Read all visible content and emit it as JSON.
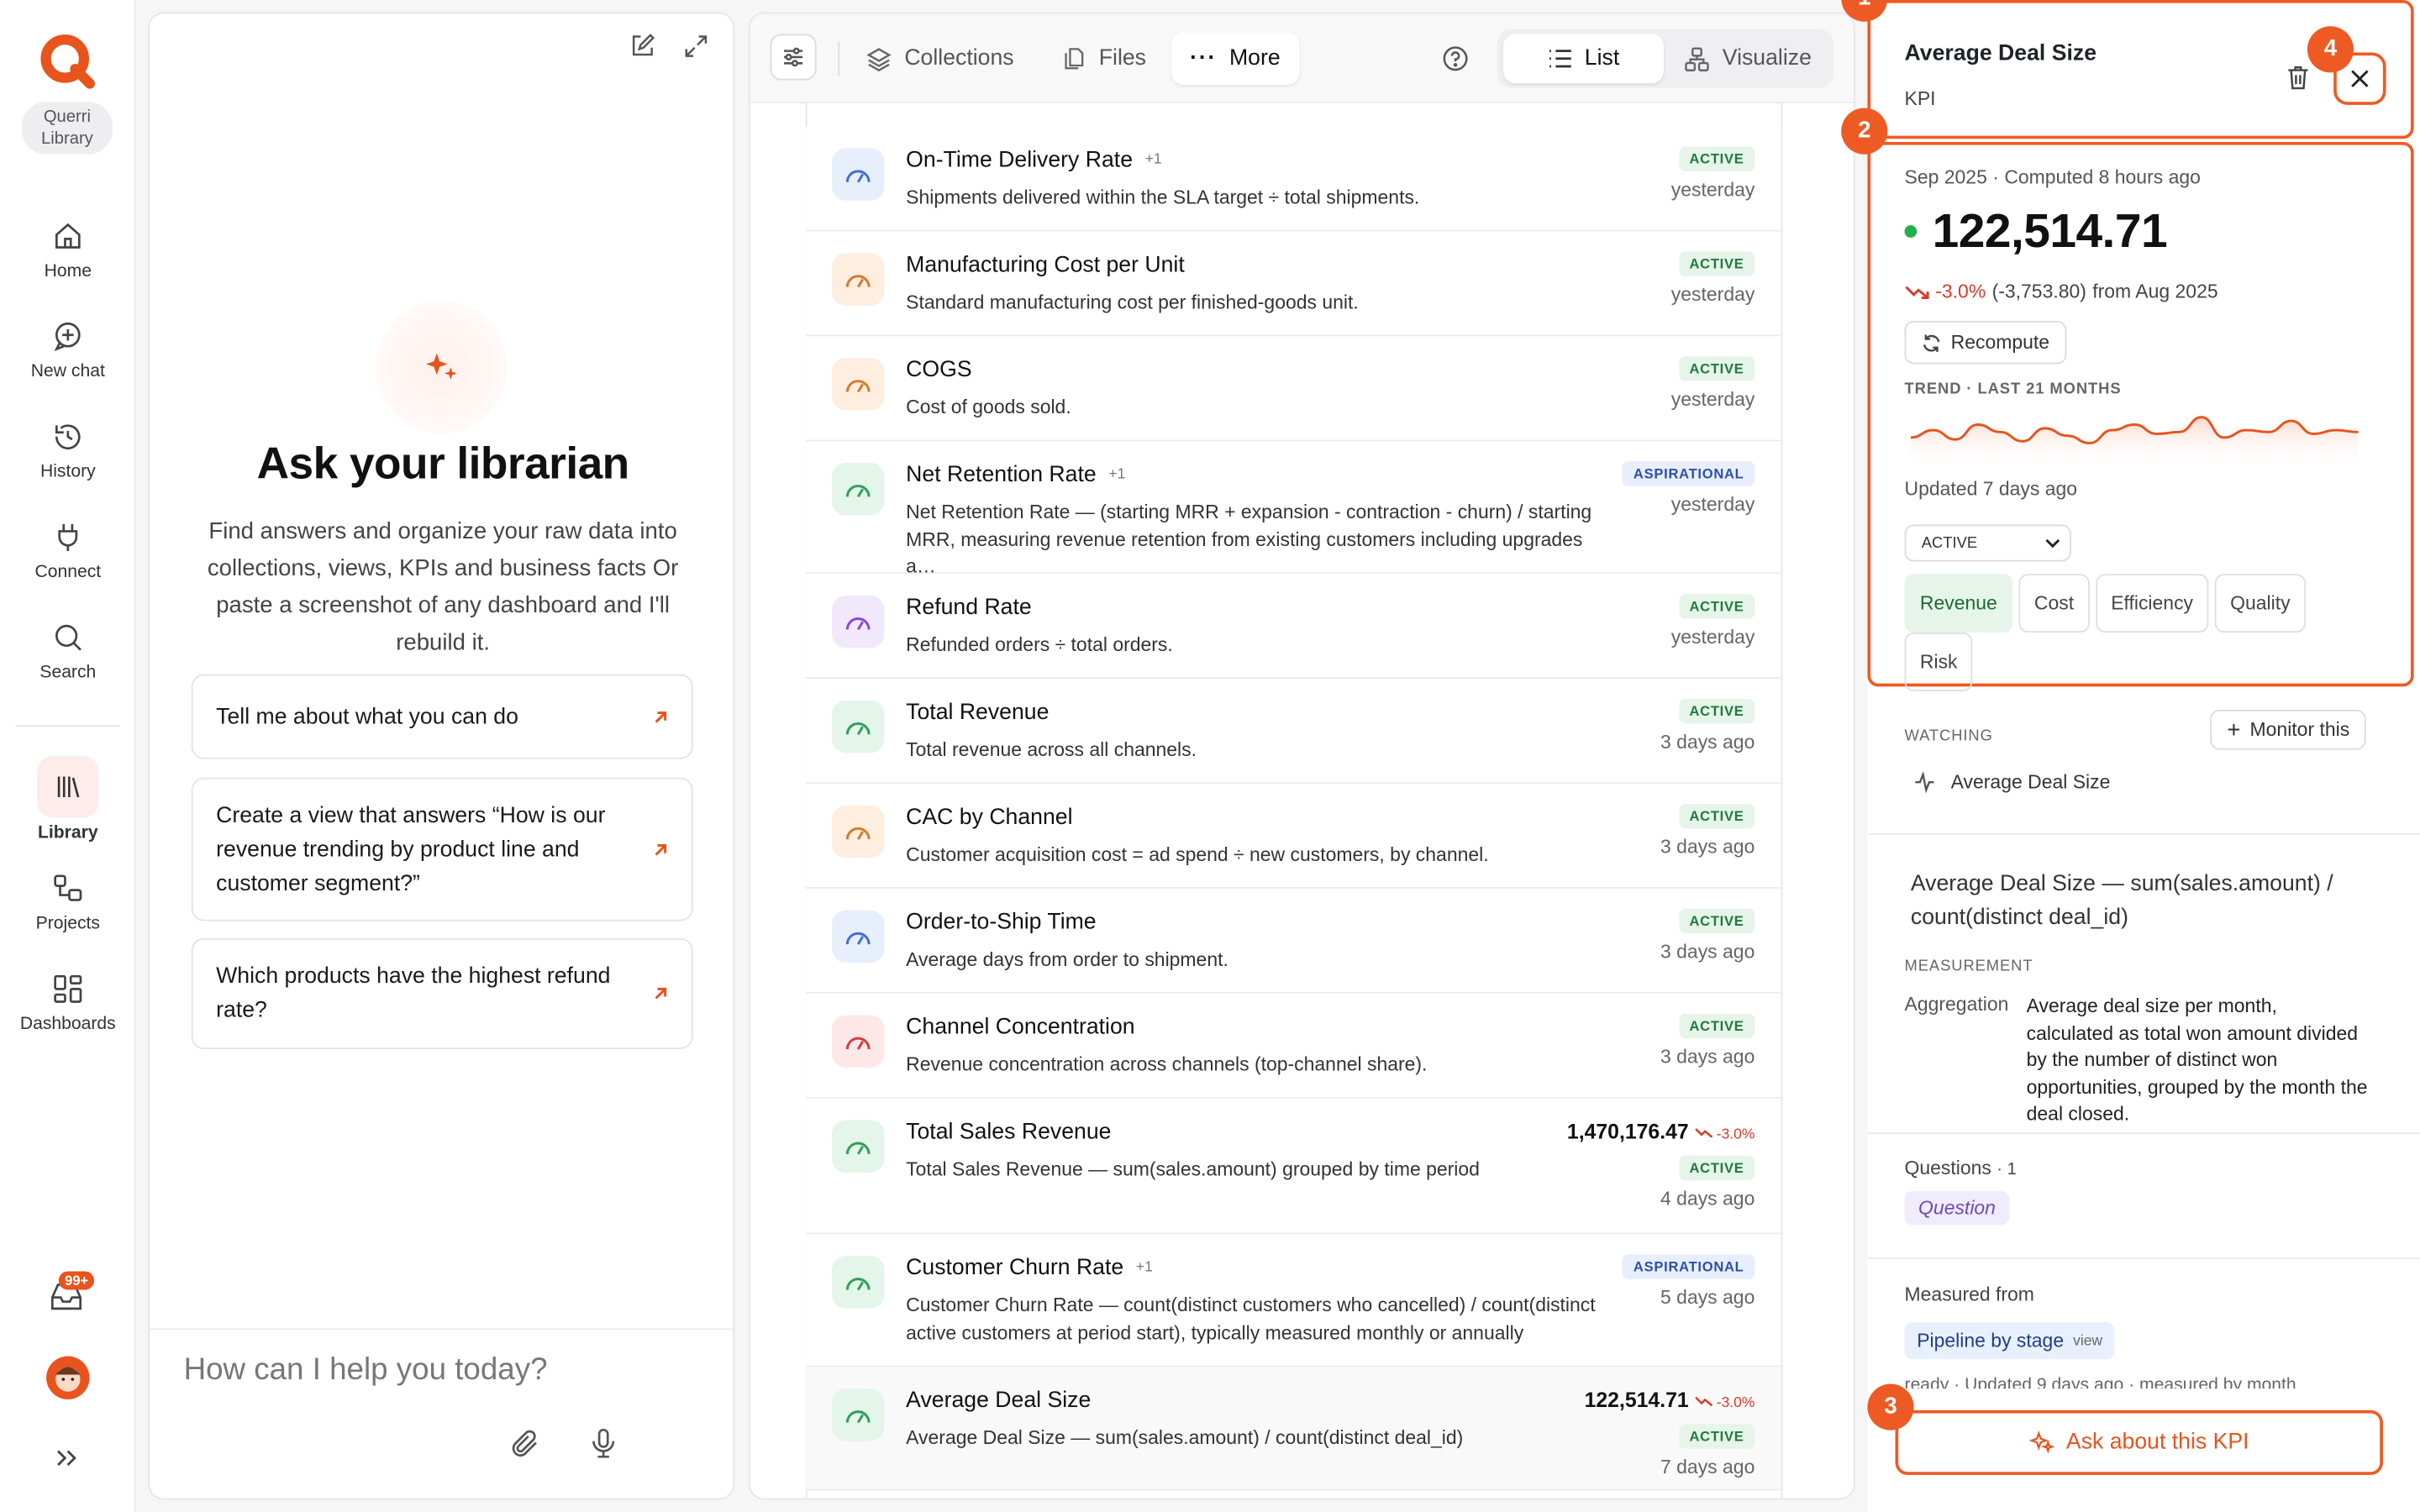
{
  "nav": {
    "library_pill": [
      "Querri",
      "Library"
    ],
    "items": [
      {
        "id": "home",
        "label": "Home",
        "icon": "home-icon"
      },
      {
        "id": "new-chat",
        "label": "New chat",
        "icon": "chat-plus-icon"
      },
      {
        "id": "history",
        "label": "History",
        "icon": "history-icon"
      },
      {
        "id": "connect",
        "label": "Connect",
        "icon": "plug-icon"
      },
      {
        "id": "search",
        "label": "Search",
        "icon": "search-icon"
      },
      {
        "id": "library",
        "label": "Library",
        "icon": "library-icon",
        "active": true
      },
      {
        "id": "projects",
        "label": "Projects",
        "icon": "projects-icon"
      },
      {
        "id": "dashboards",
        "label": "Dashboards",
        "icon": "dashboard-icon"
      }
    ],
    "inbox_badge": "99+"
  },
  "chat": {
    "title": "Ask your librarian",
    "subtitle": "Find answers and organize your raw data into collections, views, KPIs and business facts Or paste a screenshot of any dashboard and I'll rebuild it.",
    "suggestions": [
      "Tell me about what you can do",
      "Create a view that answers “How is our revenue trending by product line and customer segment?”",
      "Which products have the highest refund rate?"
    ],
    "input_placeholder": "How can I help you today?"
  },
  "toolbar": {
    "collections": "Collections",
    "files": "Files",
    "more": "More",
    "list": "List",
    "visualize": "Visualize"
  },
  "kpis": [
    {
      "name": "On-Time Delivery Rate",
      "plus": "+1",
      "desc": "Shipments delivered within the SLA target ÷ total shipments.",
      "status": "ACTIVE",
      "time": "yesterday",
      "color": "#3b6fd8",
      "bg": "#e7effc"
    },
    {
      "name": "Manufacturing Cost per Unit",
      "plus": "",
      "desc": "Standard manufacturing cost per finished-goods unit.",
      "status": "ACTIVE",
      "time": "yesterday",
      "color": "#d9792b",
      "bg": "#fdeedf"
    },
    {
      "name": "COGS",
      "plus": "",
      "desc": "Cost of goods sold.",
      "status": "ACTIVE",
      "time": "yesterday",
      "color": "#d9792b",
      "bg": "#fdeedf"
    },
    {
      "name": "Net Retention Rate",
      "plus": "+1",
      "desc": "Net Retention Rate — (starting MRR + expansion - contraction - churn) / starting MRR, measuring revenue retention from existing customers including upgrades a…",
      "status": "ASPIRATIONAL",
      "time": "yesterday",
      "color": "#2f9e5a",
      "bg": "#e4f5ea"
    },
    {
      "name": "Refund Rate",
      "plus": "",
      "desc": "Refunded orders ÷ total orders.",
      "status": "ACTIVE",
      "time": "yesterday",
      "color": "#8e47d6",
      "bg": "#f1e8fb"
    },
    {
      "name": "Total Revenue",
      "plus": "",
      "desc": "Total revenue across all channels.",
      "status": "ACTIVE",
      "time": "3 days ago",
      "color": "#2f9e5a",
      "bg": "#e4f5ea"
    },
    {
      "name": "CAC by Channel",
      "plus": "",
      "desc": "Customer acquisition cost = ad spend ÷ new customers, by channel.",
      "status": "ACTIVE",
      "time": "3 days ago",
      "color": "#d9792b",
      "bg": "#fdeedf"
    },
    {
      "name": "Order-to-Ship Time",
      "plus": "",
      "desc": "Average days from order to shipment.",
      "status": "ACTIVE",
      "time": "3 days ago",
      "color": "#3b6fd8",
      "bg": "#e7effc"
    },
    {
      "name": "Channel Concentration",
      "plus": "",
      "desc": "Revenue concentration across channels (top-channel share).",
      "status": "ACTIVE",
      "time": "3 days ago",
      "color": "#d23b3b",
      "bg": "#fde7e7"
    },
    {
      "name": "Total Sales Revenue",
      "plus": "",
      "desc": "Total Sales Revenue — sum(sales.amount) grouped by time period",
      "status": "ACTIVE",
      "time": "4 days ago",
      "value": "1,470,176.47",
      "change": "-3.0%",
      "color": "#2f9e5a",
      "bg": "#e4f5ea"
    },
    {
      "name": "Customer Churn Rate",
      "plus": "+1",
      "desc": "Customer Churn Rate — count(distinct customers who cancelled) / count(distinct active customers at period start), typically measured monthly or annually",
      "status": "ASPIRATIONAL",
      "time": "5 days ago",
      "color": "#2f9e5a",
      "bg": "#e4f5ea"
    },
    {
      "name": "Average Deal Size",
      "plus": "",
      "desc": "Average Deal Size — sum(sales.amount) / count(distinct deal_id)",
      "status": "ACTIVE",
      "time": "7 days ago",
      "value": "122,514.71",
      "change": "-3.0%",
      "color": "#2f9e5a",
      "bg": "#e4f5ea",
      "highlight": true
    }
  ],
  "detail": {
    "title": "Average Deal Size",
    "kind": "KPI",
    "period": "Sep 2025",
    "computed": "Computed 8 hours ago",
    "value": "122,514.71",
    "change_pct": "-3.0%",
    "change_abs": "(-3,753.80)",
    "change_from": "from Aug 2025",
    "recompute": "Recompute",
    "trend_label": "TREND · LAST 21 MONTHS",
    "trend": [
      0.35,
      0.55,
      0.3,
      0.7,
      0.5,
      0.25,
      0.6,
      0.4,
      0.2,
      0.55,
      0.7,
      0.45,
      0.5,
      0.9,
      0.35,
      0.55,
      0.5,
      0.8,
      0.45,
      0.55,
      0.5
    ],
    "updated": "Updated 7 days ago",
    "status_select": "ACTIVE",
    "tags": [
      {
        "label": "Revenue",
        "on": true
      },
      {
        "label": "Cost"
      },
      {
        "label": "Efficiency"
      },
      {
        "label": "Quality"
      },
      {
        "label": "Risk"
      }
    ],
    "watching_label": "WATCHING",
    "monitor": "Monitor this",
    "watching_item": "Average Deal Size",
    "formula": "Average Deal Size — sum(sales.amount) / count(distinct deal_id)",
    "measurement_label": "MEASUREMENT",
    "aggregation_key": "Aggregation",
    "aggregation_val": "Average deal size per month, calculated as total won amount divided by the number of distinct won opportunities, grouped by the month the deal closed.",
    "questions_label": "Questions",
    "questions_count": "· 1",
    "question_chip": "Question",
    "measured_from": "Measured from",
    "source": "Pipeline by stage",
    "source_kind": "view",
    "source_meta": "ready · Updated 9 days ago · measured by month",
    "ask": "Ask about this KPI",
    "markers": [
      "1",
      "2",
      "3",
      "4"
    ],
    "accent": "#ee5a24"
  }
}
